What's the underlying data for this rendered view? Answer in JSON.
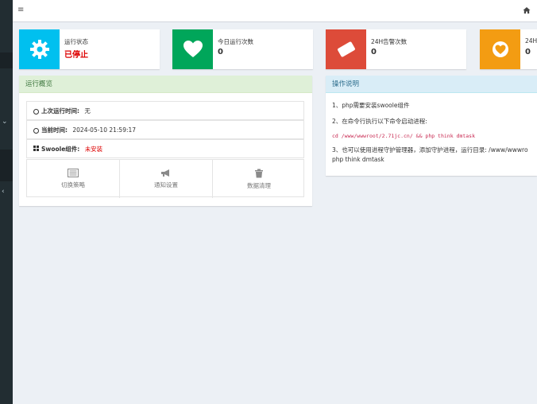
{
  "topbar": {
    "menu_icon": "bars-icon",
    "home_icon": "home-icon"
  },
  "info_boxes": [
    {
      "label": "运行状态",
      "value": "已停止",
      "color": "#00c0ef",
      "icon": "gear-icon"
    },
    {
      "label": "今日运行次数",
      "value": "0",
      "color": "#00a65a",
      "icon": "heart-icon"
    },
    {
      "label": "24H告警次数",
      "value": "0",
      "color": "#dd4b39",
      "icon": "ticket-icon"
    },
    {
      "label": "24H",
      "value": "0",
      "color": "#f39c12",
      "icon": "heart-circle-icon"
    }
  ],
  "overview": {
    "title": "运行概览",
    "last_run_label": "上次运行时间:",
    "last_run_value": "无",
    "current_time_label": "当前时间:",
    "current_time_value": "2024-05-10 21:59:17",
    "swoole_label": "Swoole组件:",
    "swoole_value": "未安装",
    "buttons": [
      {
        "label": "切换策略",
        "icon": "list-icon"
      },
      {
        "label": "通知设置",
        "icon": "bullhorn-icon"
      },
      {
        "label": "数据清理",
        "icon": "trash-icon"
      }
    ]
  },
  "help": {
    "title": "操作说明",
    "line1": "1、php需要安装swoole组件",
    "line2": "2、在命令行执行以下命令启动进程:",
    "command": "cd /www/wwwroot/2.71jc.cn/ && php think dmtask",
    "line3": "3、也可以使用进程守护管理器，添加守护进程，运行目录: /www/wwwro",
    "line3b": "php think dmtask"
  }
}
